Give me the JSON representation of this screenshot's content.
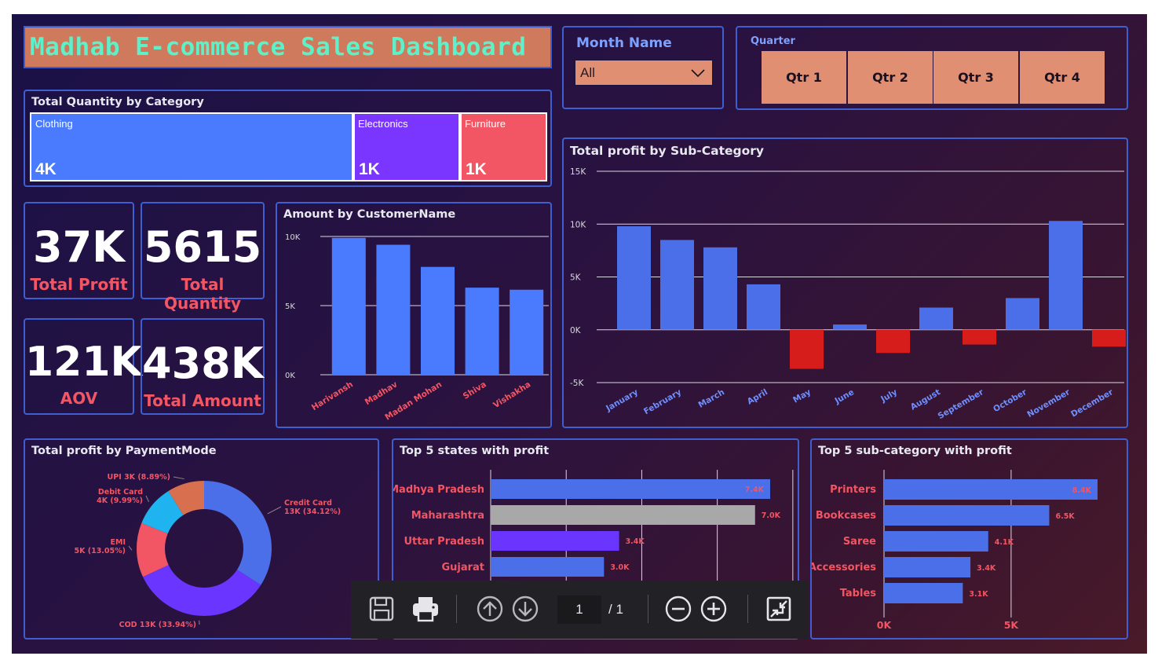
{
  "title": "Madhab E-commerce Sales Dashboard",
  "month_filter": {
    "label": "Month Name",
    "value": "All"
  },
  "quarter_filter": {
    "label": "Quarter",
    "options": [
      "Qtr 1",
      "Qtr 2",
      "Qtr 3",
      "Qtr 4"
    ]
  },
  "category_treemap": {
    "title": "Total Quantity by Category",
    "items": [
      {
        "name": "Clothing",
        "value": "4K",
        "color": "#4a7bff"
      },
      {
        "name": "Electronics",
        "value": "1K",
        "color": "#7a35ff"
      },
      {
        "name": "Furniture",
        "value": "1K",
        "color": "#f25563"
      }
    ]
  },
  "kpis": [
    {
      "value": "37K",
      "label": "Total Profit"
    },
    {
      "value": "5615",
      "label": "Total Quantity"
    },
    {
      "value": "121K",
      "label": "AOV"
    },
    {
      "value": "438K",
      "label": "Total Amount"
    }
  ],
  "chart_data": [
    {
      "id": "customer",
      "type": "bar",
      "title": "Amount by CustomerName",
      "categories": [
        "Harivansh",
        "Madhav",
        "Madan Mohan",
        "Shiva",
        "Vishakha"
      ],
      "values": [
        9900,
        9400,
        7800,
        6300,
        6150
      ],
      "yticks": [
        "0K",
        "5K",
        "10K"
      ],
      "ylim": [
        0,
        10000
      ],
      "color": "#4a7bff"
    },
    {
      "id": "subcat",
      "type": "bar",
      "title": "Total profit by Sub-Category",
      "categories": [
        "January",
        "February",
        "March",
        "April",
        "May",
        "June",
        "July",
        "August",
        "September",
        "October",
        "November",
        "December"
      ],
      "values": [
        9800,
        8500,
        7800,
        4300,
        -3700,
        500,
        -2200,
        2100,
        -1400,
        3000,
        10300,
        -1600
      ],
      "yticks": [
        "-5K",
        "0K",
        "5K",
        "10K",
        "15K"
      ],
      "ylim": [
        -5000,
        15000
      ],
      "pos_color": "#4a6fe8",
      "neg_color": "#d71c1c"
    },
    {
      "id": "payment",
      "type": "pie",
      "title": "Total profit by PaymentMode",
      "slices": [
        {
          "name": "Credit Card",
          "label": "Credit Card\n13K (34.12%)",
          "value": 34.12,
          "color": "#4a6fe8"
        },
        {
          "name": "COD",
          "label": "COD 13K (33.94%)",
          "value": 33.94,
          "color": "#6a35ff"
        },
        {
          "name": "EMI",
          "label": "EMI\n5K (13.05%)",
          "value": 13.05,
          "color": "#f25563"
        },
        {
          "name": "Debit Card",
          "label": "Debit Card\n4K (9.99%)",
          "value": 9.99,
          "color": "#1fb3f0"
        },
        {
          "name": "UPI",
          "label": "UPI 3K (8.89%)",
          "value": 8.89,
          "color": "#d8704f"
        }
      ]
    },
    {
      "id": "states",
      "type": "bar",
      "title": "Top 5 states with profit",
      "categories": [
        "Madhya Pradesh",
        "Maharashtra",
        "Uttar Pradesh",
        "Gujarat"
      ],
      "values": [
        7400,
        7000,
        3400,
        3000
      ],
      "labels": [
        "7.4K",
        "7.0K",
        "3.4K",
        "3.0K"
      ],
      "colors": [
        "#4a6fe8",
        "#a8a8a8",
        "#6a35ff",
        "#4a6fe8"
      ]
    },
    {
      "id": "topsub",
      "type": "bar",
      "title": "Top 5 sub-category with profit",
      "categories": [
        "Printers",
        "Bookcases",
        "Saree",
        "Accessories",
        "Tables"
      ],
      "values": [
        8400,
        6500,
        4100,
        3400,
        3100
      ],
      "labels": [
        "8.4K",
        "6.5K",
        "4.1K",
        "3.4K",
        "3.1K"
      ],
      "xticks": [
        "0K",
        "5K"
      ],
      "color": "#4a6fe8"
    }
  ],
  "toolbar": {
    "page": "1",
    "of": "/ 1"
  }
}
